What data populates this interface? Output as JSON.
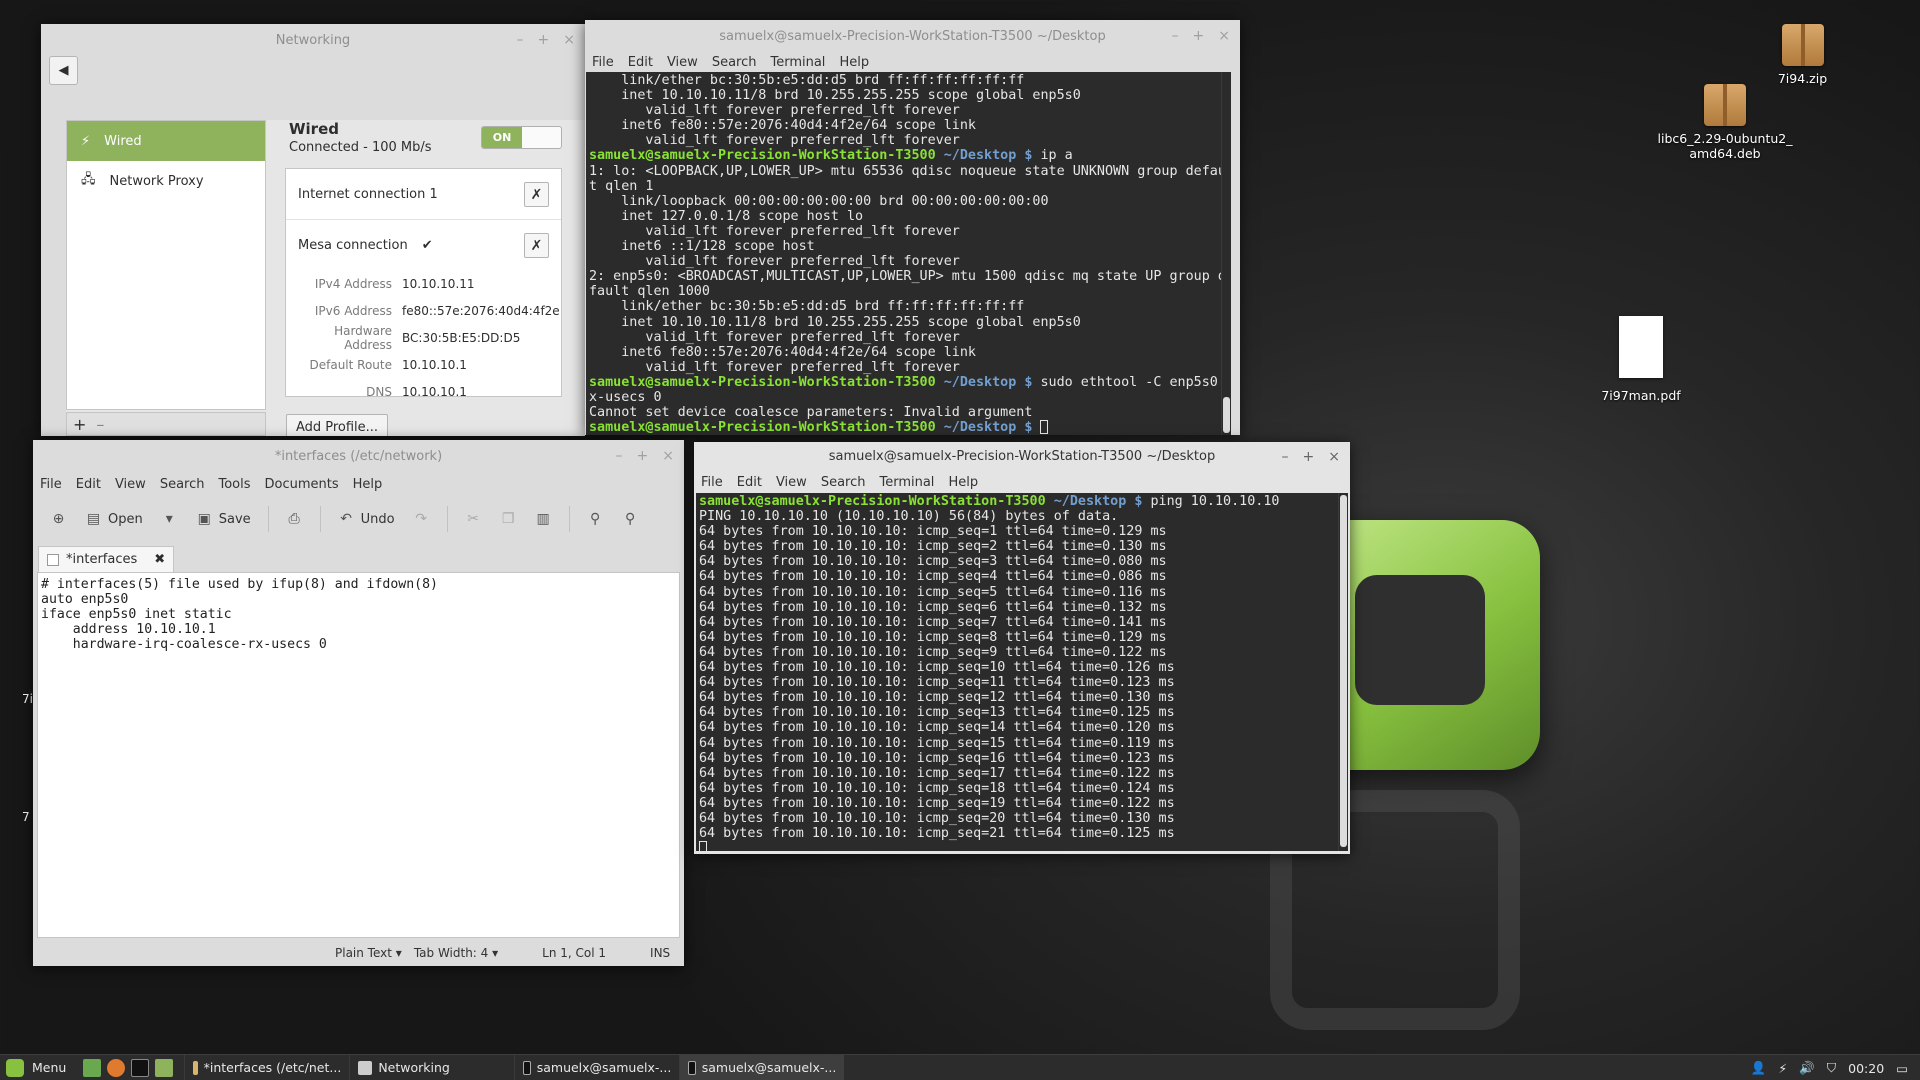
{
  "desktop": {
    "icons": [
      {
        "name": "7i94.zip"
      },
      {
        "name": "libc6_2.29-0ubuntu2_amd64.deb",
        "line1": "libc6_2.29-0ubuntu2_",
        "line2": "amd64.deb"
      },
      {
        "name": "7i97man.pdf"
      }
    ],
    "edge_fragments": [
      "7i",
      "7"
    ]
  },
  "networking": {
    "title": "Networking",
    "sidebar": [
      {
        "label": "Wired",
        "icon": "plug-icon"
      },
      {
        "label": "Network Proxy",
        "icon": "proxy-icon"
      }
    ],
    "wired_title": "Wired",
    "wired_status": "Connected - 100 Mb/s",
    "toggle_label": "ON",
    "profiles": [
      "Internet connection 1",
      "Mesa connection"
    ],
    "details": [
      {
        "k": "IPv4 Address",
        "v": "10.10.10.11"
      },
      {
        "k": "IPv6 Address",
        "v": "fe80::57e:2076:40d4:4f2e"
      },
      {
        "k": "Hardware Address",
        "v": "BC:30:5B:E5:DD:D5"
      },
      {
        "k": "Default Route",
        "v": "10.10.10.1"
      },
      {
        "k": "DNS",
        "v": "10.10.10.1"
      }
    ],
    "add_profile": "Add Profile..."
  },
  "terminal1": {
    "title": "samuelx@samuelx-Precision-WorkStation-T3500 ~/Desktop",
    "menu": [
      "File",
      "Edit",
      "View",
      "Search",
      "Terminal",
      "Help"
    ],
    "prompt_user": "samuelx@samuelx-Precision-WorkStation-T3500",
    "prompt_cwd": "~/Desktop $",
    "lines": [
      "    link/ether bc:30:5b:e5:dd:d5 brd ff:ff:ff:ff:ff:ff",
      "    inet 10.10.10.11/8 brd 10.255.255.255 scope global enp5s0",
      "       valid_lft forever preferred_lft forever",
      "    inet6 fe80::57e:2076:40d4:4f2e/64 scope link",
      "       valid_lft forever preferred_lft forever",
      "1: lo: <LOOPBACK,UP,LOWER_UP> mtu 65536 qdisc noqueue state UNKNOWN group defaul",
      "t qlen 1",
      "    link/loopback 00:00:00:00:00:00 brd 00:00:00:00:00:00",
      "    inet 127.0.0.1/8 scope host lo",
      "       valid_lft forever preferred_lft forever",
      "    inet6 ::1/128 scope host",
      "       valid_lft forever preferred_lft forever",
      "2: enp5s0: <BROADCAST,MULTICAST,UP,LOWER_UP> mtu 1500 qdisc mq state UP group de",
      "fault qlen 1000",
      "    link/ether bc:30:5b:e5:dd:d5 brd ff:ff:ff:ff:ff:ff",
      "    inet 10.10.10.11/8 brd 10.255.255.255 scope global enp5s0",
      "       valid_lft forever preferred_lft forever",
      "    inet6 fe80::57e:2076:40d4:4f2e/64 scope link",
      "       valid_lft forever preferred_lft forever",
      "x-usecs 0",
      "Cannot set device coalesce parameters: Invalid argument"
    ],
    "cmd_ip": " ip a",
    "cmd_ethtool": " sudo ethtool -C enp5s0 r"
  },
  "gedit": {
    "title": "*interfaces (/etc/network)",
    "menu": [
      "File",
      "Edit",
      "View",
      "Search",
      "Tools",
      "Documents",
      "Help"
    ],
    "toolbar": {
      "open": "Open",
      "save": "Save",
      "undo": "Undo"
    },
    "tab_label": "*interfaces",
    "content": [
      "# interfaces(5) file used by ifup(8) and ifdown(8)",
      "auto enp5s0",
      "iface enp5s0 inet static",
      "",
      "    address 10.10.10.1",
      "    hardware-irq-coalesce-rx-usecs 0"
    ],
    "status": {
      "lang": "Plain Text",
      "tab_width": "Tab Width:  4",
      "pos": "Ln 1, Col 1",
      "mode": "INS"
    }
  },
  "terminal2": {
    "title": "samuelx@samuelx-Precision-WorkStation-T3500 ~/Desktop",
    "menu": [
      "File",
      "Edit",
      "View",
      "Search",
      "Terminal",
      "Help"
    ],
    "prompt_user": "samuelx@samuelx-Precision-WorkStation-T3500",
    "prompt_cwd": "~/Desktop $",
    "cmd": " ping 10.10.10.10",
    "header": "PING 10.10.10.10 (10.10.10.10) 56(84) bytes of data.",
    "ping_lines": [
      "64 bytes from 10.10.10.10: icmp_seq=1 ttl=64 time=0.129 ms",
      "64 bytes from 10.10.10.10: icmp_seq=2 ttl=64 time=0.130 ms",
      "64 bytes from 10.10.10.10: icmp_seq=3 ttl=64 time=0.080 ms",
      "64 bytes from 10.10.10.10: icmp_seq=4 ttl=64 time=0.086 ms",
      "64 bytes from 10.10.10.10: icmp_seq=5 ttl=64 time=0.116 ms",
      "64 bytes from 10.10.10.10: icmp_seq=6 ttl=64 time=0.132 ms",
      "64 bytes from 10.10.10.10: icmp_seq=7 ttl=64 time=0.141 ms",
      "64 bytes from 10.10.10.10: icmp_seq=8 ttl=64 time=0.129 ms",
      "64 bytes from 10.10.10.10: icmp_seq=9 ttl=64 time=0.122 ms",
      "64 bytes from 10.10.10.10: icmp_seq=10 ttl=64 time=0.126 ms",
      "64 bytes from 10.10.10.10: icmp_seq=11 ttl=64 time=0.123 ms",
      "64 bytes from 10.10.10.10: icmp_seq=12 ttl=64 time=0.130 ms",
      "64 bytes from 10.10.10.10: icmp_seq=13 ttl=64 time=0.125 ms",
      "64 bytes from 10.10.10.10: icmp_seq=14 ttl=64 time=0.120 ms",
      "64 bytes from 10.10.10.10: icmp_seq=15 ttl=64 time=0.119 ms",
      "64 bytes from 10.10.10.10: icmp_seq=16 ttl=64 time=0.123 ms",
      "64 bytes from 10.10.10.10: icmp_seq=17 ttl=64 time=0.122 ms",
      "64 bytes from 10.10.10.10: icmp_seq=18 ttl=64 time=0.124 ms",
      "64 bytes from 10.10.10.10: icmp_seq=19 ttl=64 time=0.122 ms",
      "64 bytes from 10.10.10.10: icmp_seq=20 ttl=64 time=0.130 ms",
      "64 bytes from 10.10.10.10: icmp_seq=21 ttl=64 time=0.125 ms"
    ]
  },
  "taskbar": {
    "menu_label": "Menu",
    "tasks": [
      "*interfaces (/etc/net...",
      "Networking",
      "samuelx@samuelx-...",
      "samuelx@samuelx-..."
    ],
    "clock": "00:20"
  },
  "colors": {
    "accent": "#8fb25d",
    "prompt": "#8ae234",
    "cwd": "#729fcf",
    "terminal_bg": "#2b2b2b"
  }
}
